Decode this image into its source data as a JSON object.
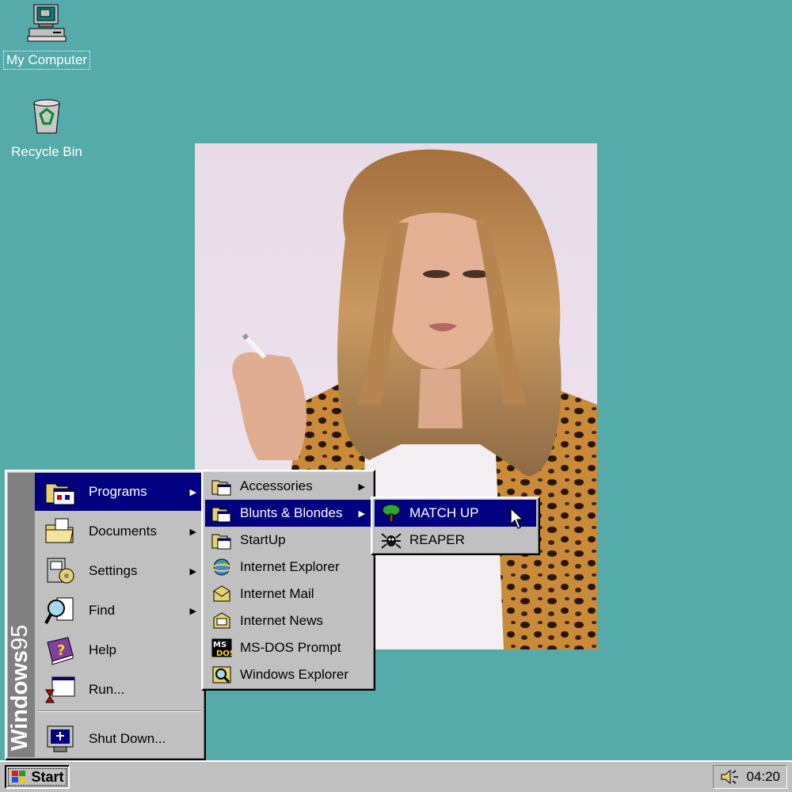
{
  "desktop": {
    "icons": [
      {
        "label": "My Computer"
      },
      {
        "label": "Recycle Bin"
      }
    ],
    "background_color": "#55aaaa"
  },
  "start_menu": {
    "banner_bold": "Windows",
    "banner_version": "95",
    "items": [
      {
        "label": "Programs",
        "has_submenu": true,
        "icon": "programs-icon"
      },
      {
        "label": "Documents",
        "has_submenu": true,
        "icon": "documents-icon"
      },
      {
        "label": "Settings",
        "has_submenu": true,
        "icon": "settings-icon"
      },
      {
        "label": "Find",
        "has_submenu": true,
        "icon": "find-icon"
      },
      {
        "label": "Help",
        "has_submenu": false,
        "icon": "help-icon"
      },
      {
        "label": "Run...",
        "has_submenu": false,
        "icon": "run-icon"
      },
      {
        "label": "Shut Down...",
        "has_submenu": false,
        "icon": "shutdown-icon"
      }
    ]
  },
  "programs_menu": {
    "items": [
      {
        "label": "Accessories",
        "has_submenu": true
      },
      {
        "label": "Blunts & Blondes",
        "has_submenu": true
      },
      {
        "label": "StartUp",
        "has_submenu": false
      },
      {
        "label": "Internet Explorer",
        "has_submenu": false
      },
      {
        "label": "Internet Mail",
        "has_submenu": false
      },
      {
        "label": "Internet News",
        "has_submenu": false
      },
      {
        "label": "MS-DOS Prompt",
        "has_submenu": false
      },
      {
        "label": "Windows Explorer",
        "has_submenu": false
      }
    ]
  },
  "blunts_menu": {
    "items": [
      {
        "label": "MATCH UP",
        "icon": "tree-icon"
      },
      {
        "label": "REAPER",
        "icon": "spider-icon"
      }
    ]
  },
  "taskbar": {
    "start_label": "Start",
    "clock": "04:20"
  },
  "colors": {
    "highlight": "#000080",
    "face": "#c0c0c0"
  }
}
